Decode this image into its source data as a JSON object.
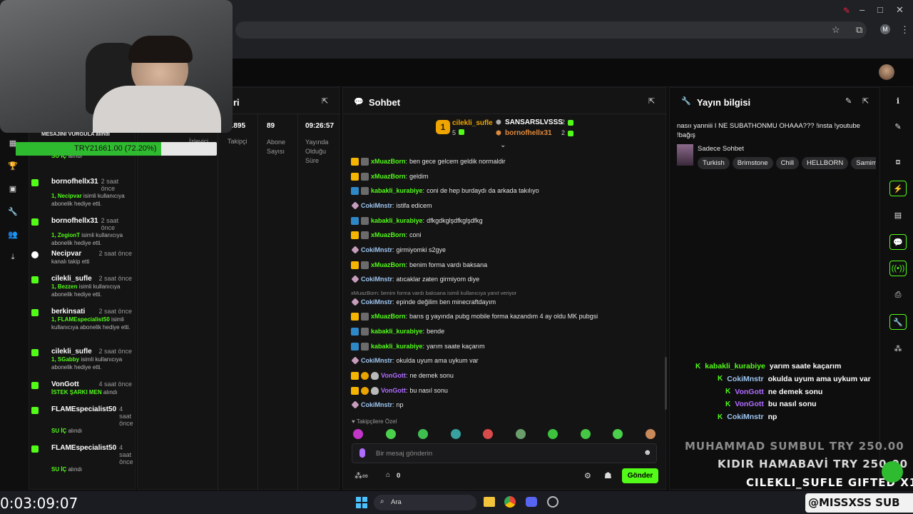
{
  "browser": {
    "profile_initial": "M"
  },
  "stats": {
    "header_partial": "ri",
    "items": [
      {
        "value": "2.895",
        "label": "Takipçi"
      },
      {
        "value": "89",
        "label": "Abone Sayısı"
      },
      {
        "value": "09:26:57",
        "label": "Yayında Olduğu Süre"
      }
    ],
    "viewers_label": "İzleyici"
  },
  "donation_bar": {
    "header": "MESAJINI VURGULA alındı",
    "text": "TRY21661.00 (72.20%)",
    "progress_percent": 72.2
  },
  "activity_feed": [
    {
      "name": "",
      "time": "önce",
      "desc_hl": "SU İÇ",
      "desc": " alındı"
    },
    {
      "name": "bornofhellx31",
      "time": "2 saat önce",
      "desc_hl": "1, Necipvar",
      "desc": " isimli kullanıcıya abonelik hediye etti."
    },
    {
      "name": "bornofhellx31",
      "time": "2 saat önce",
      "desc_hl": "1, ZegionT",
      "desc": " isimli kullanıcıya abonelik hediye etti."
    },
    {
      "name": "Necipvar",
      "time": "2 saat önce",
      "desc_hl": "",
      "desc": "kanalı takip etti"
    },
    {
      "name": "cilekli_sufle",
      "time": "2 saat önce",
      "desc_hl": "1, Bezzen",
      "desc": " isimli kullanıcıya abonelik hediye etti."
    },
    {
      "name": "berkinsati",
      "time": "2 saat önce",
      "desc_hl": "1, FLAMEspecialist50",
      "desc": " isimli kullanıcıya abonelik hediye etti."
    },
    {
      "name": "cilekli_sufle",
      "time": "2 saat önce",
      "desc_hl": "1, SGabby",
      "desc": " isimli kullanıcıya abonelik hediye etti."
    },
    {
      "name": "VonGott",
      "time": "4 saat önce",
      "desc_hl": "İSTEK ŞARKI MEN",
      "desc": " alındı"
    },
    {
      "name": "FLAMEspecialist50",
      "time": "4 saat önce",
      "desc_hl": "SU İÇ",
      "desc": " alındı"
    },
    {
      "name": "FLAMEspecialist50",
      "time": "4 saat önce",
      "desc_hl": "SU İÇ",
      "desc": " alındı"
    }
  ],
  "chat": {
    "title": "Sohbet",
    "top_gifters": {
      "first": {
        "name": "cilekli_sufle",
        "count": "5",
        "rank": "1"
      },
      "others": [
        {
          "name": "SANSARSLVSSS",
          "count": "2"
        },
        {
          "name": "bornofhellx31",
          "count": "2"
        }
      ]
    },
    "messages": [
      {
        "badges": [
          "b-crown",
          "b-ava"
        ],
        "user": "xMuazBorn",
        "ucls": "u-green",
        "text": "ben gece gelcem geldik normaldir"
      },
      {
        "badges": [
          "b-crown",
          "b-ava"
        ],
        "user": "xMuazBorn",
        "ucls": "u-green",
        "text": "geldim"
      },
      {
        "badges": [
          "b-blue",
          "b-ava"
        ],
        "user": "kabakli_kurabiye",
        "ucls": "u-green",
        "text": "coni de hep burdaydı da arkada takılıyo"
      },
      {
        "badges": [
          "b-pink"
        ],
        "user": "CokiMnstr",
        "ucls": "u-blue",
        "text": "istifa edicem"
      },
      {
        "badges": [
          "b-blue",
          "b-ava"
        ],
        "user": "kabakli_kurabiye",
        "ucls": "u-green",
        "text": "dfkgdkglşdfkglşdfkg"
      },
      {
        "badges": [
          "b-crown",
          "b-ava"
        ],
        "user": "xMuazBorn",
        "ucls": "u-green",
        "text": "coni"
      },
      {
        "badges": [
          "b-pink"
        ],
        "user": "CokiMnstr",
        "ucls": "u-blue",
        "text": "girmiyomki s2gye"
      },
      {
        "badges": [
          "b-crown",
          "b-ava"
        ],
        "user": "xMuazBorn",
        "ucls": "u-green",
        "text": "benim forma vardı baksana"
      },
      {
        "badges": [
          "b-pink"
        ],
        "user": "CokiMnstr",
        "ucls": "u-blue",
        "text": "atıcaklar zaten girmiyom diye"
      },
      {
        "reply": "xMuazBorn: benim forma vardı baksana isimli kullanıcıya yanıt veriyor",
        "badges": [
          "b-pink"
        ],
        "user": "CokiMnstr",
        "ucls": "u-blue",
        "text": "epinde değilim ben minecraftdayım"
      },
      {
        "badges": [
          "b-crown",
          "b-ava"
        ],
        "user": "xMuazBorn",
        "ucls": "u-green",
        "text": "barıs g yayında pubg mobile forma kazandım 4 ay oldu MK pubgsi"
      },
      {
        "badges": [
          "b-blue",
          "b-ava"
        ],
        "user": "kabakli_kurabiye",
        "ucls": "u-green",
        "text": "bende"
      },
      {
        "badges": [
          "b-blue",
          "b-ava"
        ],
        "user": "kabakli_kurabiye",
        "ucls": "u-green",
        "text": "yarım saate kaçarım"
      },
      {
        "badges": [
          "b-pink"
        ],
        "user": "CokiMnstr",
        "ucls": "u-blue",
        "text": "okulda uyum ama uykum var"
      },
      {
        "badges": [
          "b-crown",
          "b-gold",
          "b-flame"
        ],
        "user": "VonGott",
        "ucls": "u-purple",
        "text": "ne demek sonu"
      },
      {
        "badges": [
          "b-crown",
          "b-gold",
          "b-flame"
        ],
        "user": "VonGott",
        "ucls": "u-purple",
        "text": "bu nasıl sonu"
      },
      {
        "badges": [
          "b-pink"
        ],
        "user": "CokiMnstr",
        "ucls": "u-blue",
        "text": "np"
      }
    ],
    "followers_only": "Takipçilere Özel",
    "input_placeholder": "Bir mesaj gönderin",
    "points": "0",
    "send_label": "Gönder"
  },
  "stream_info": {
    "title": "Yayın bilgisi",
    "stream_title": "nasıı yanniii I NE SUBATHONMU OHAAA??? !insta !youtube !bağış",
    "category": "Sadece Sohbet",
    "tags": [
      "Turkish",
      "Brimstone",
      "Chill",
      "HELLBORN",
      "Samimi"
    ]
  },
  "overlay_chat": [
    {
      "user": "kabakli_kurabiye",
      "color": "#53fc18",
      "text": "yarım saate kaçarım"
    },
    {
      "user": "CokiMnstr",
      "color": "#9ec6f0",
      "text": "okulda uyum ama uykum var"
    },
    {
      "user": "VonGott",
      "color": "#b06cff",
      "text": "ne demek sonu"
    },
    {
      "user": "VonGott",
      "color": "#b06cff",
      "text": "bu nasıl sonu"
    },
    {
      "user": "CokiMnstr",
      "color": "#9ec6f0",
      "text": "np"
    }
  ],
  "ticker": {
    "line1": "MUHAMMAD SUMBUL  TRY 250.00",
    "line2": "KIDIR HAMABAVİ  TRY 250.00",
    "line3": "CILEKLI_SUFLE  GIFTED X1",
    "handle": "@MISSXSS  SUB"
  },
  "timer": "0:03:09:07",
  "taskbar": {
    "search": "Ara"
  }
}
